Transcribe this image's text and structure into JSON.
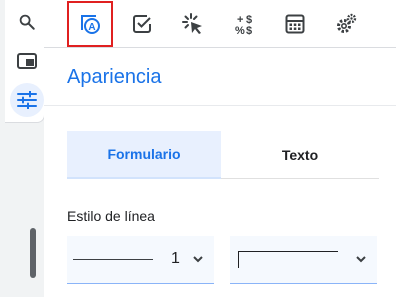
{
  "rail": {
    "buttons": [
      {
        "icon": "search-icon"
      },
      {
        "icon": "picture-in-picture-icon"
      },
      {
        "icon": "tune-sliders-icon",
        "active": true
      }
    ]
  },
  "toolbar": {
    "tools": [
      {
        "icon": "shape-style-icon",
        "selected": true
      },
      {
        "icon": "checkbox-icon"
      },
      {
        "icon": "click-cursor-icon"
      },
      {
        "icon": "price-percent-icon"
      },
      {
        "icon": "calculator-icon"
      },
      {
        "icon": "settings-gears-icon"
      }
    ]
  },
  "section": {
    "title": "Apariencia"
  },
  "tabs": {
    "formulario": "Formulario",
    "texto": "Texto"
  },
  "line_style": {
    "label": "Estilo de línea",
    "width_value": "1"
  },
  "colors": {
    "accent": "#1a73e8",
    "selection": "#e02020"
  }
}
